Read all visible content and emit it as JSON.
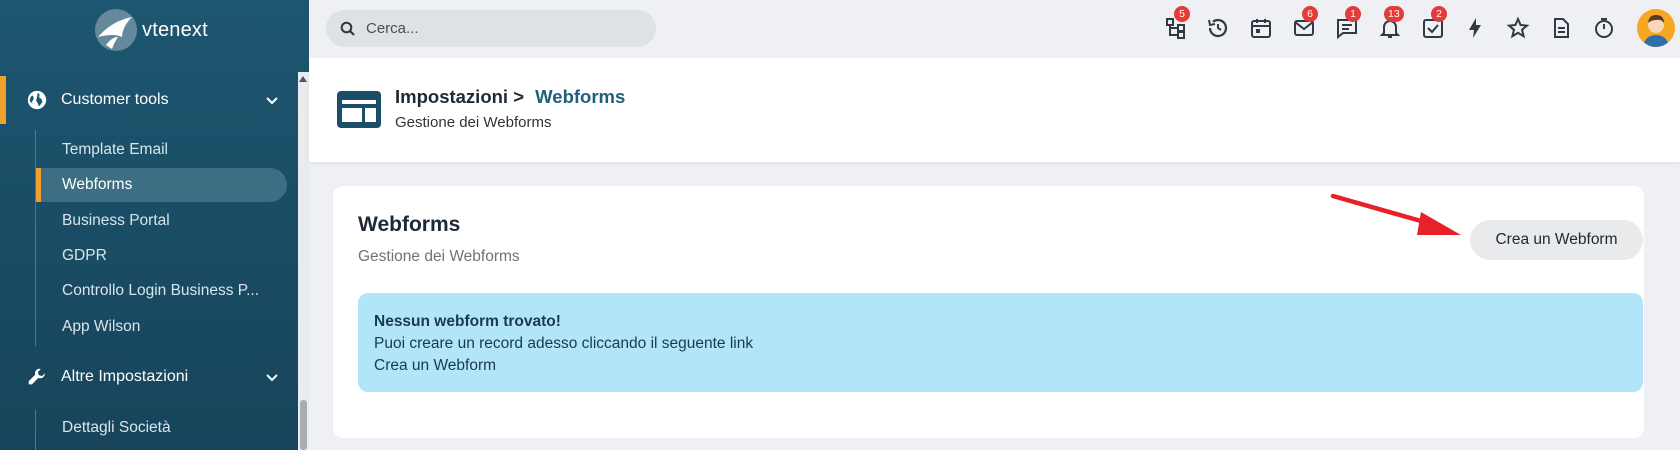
{
  "app": {
    "logo_text": "vtenext"
  },
  "sidebar": {
    "groups": [
      {
        "label": "Customer tools"
      },
      {
        "label": "Altre Impostazioni"
      }
    ],
    "customer_tools_items": [
      {
        "label": "Template Email"
      },
      {
        "label": "Webforms"
      },
      {
        "label": "Business Portal"
      },
      {
        "label": "GDPR"
      },
      {
        "label": "Controllo Login Business P..."
      },
      {
        "label": "App Wilson"
      }
    ],
    "altre_items": [
      {
        "label": "Dettagli Società"
      }
    ]
  },
  "topbar": {
    "search_placeholder": "Cerca...",
    "badges": {
      "hierarchy": "5",
      "mail": "6",
      "chat": "1",
      "notifications": "13",
      "tasks": "2"
    }
  },
  "header": {
    "crumb_root": "Impostazioni >",
    "crumb_current": "Webforms",
    "subtitle": "Gestione dei Webforms"
  },
  "card": {
    "title": "Webforms",
    "subtitle": "Gestione dei Webforms",
    "create_button": "Crea un Webform",
    "alert_title": "Nessun webform trovato!",
    "alert_text": "Puoi creare un record adesso cliccando il seguente link",
    "alert_link": "Crea un Webform"
  },
  "colors": {
    "sidebar": "#1d5670",
    "accent": "#f0a02d",
    "alert_bg": "#b3e5fa",
    "badge": "#e53a3a",
    "arrow": "#e8202a"
  }
}
